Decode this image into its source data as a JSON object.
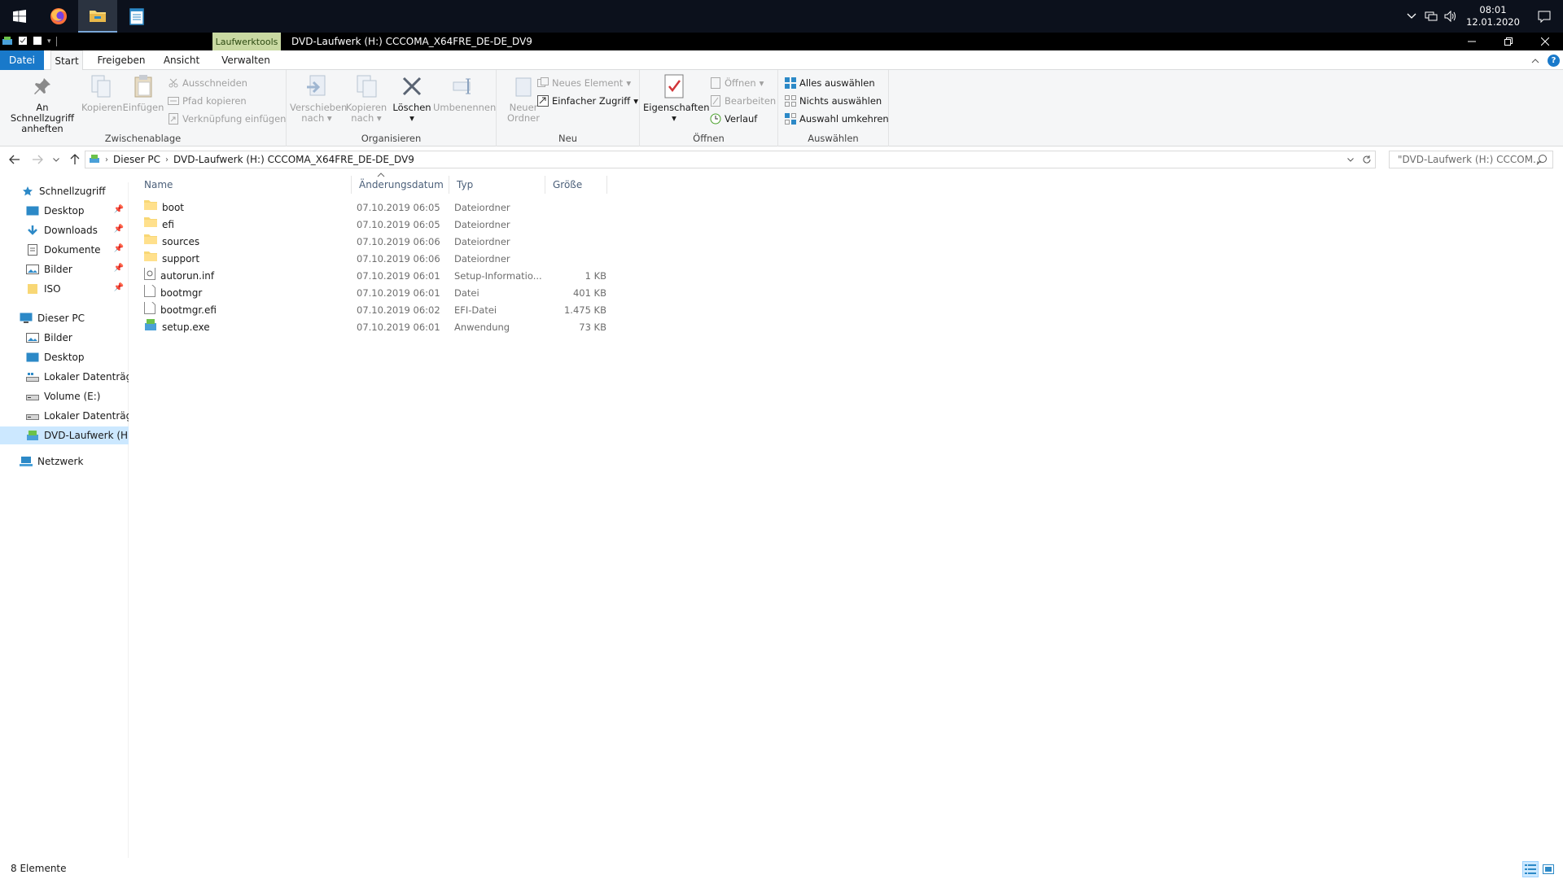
{
  "taskbar": {
    "apps": [
      {
        "name": "firefox-icon"
      },
      {
        "name": "file-explorer-icon"
      },
      {
        "name": "notepad-icon"
      }
    ],
    "clock": {
      "time": "08:01",
      "date": "12.01.2020"
    }
  },
  "titlebar": {
    "context_tab": "Laufwerktools",
    "title": "DVD-Laufwerk (H:) CCCOMA_X64FRE_DE-DE_DV9"
  },
  "ribbon_tabs": [
    "Datei",
    "Start",
    "Freigeben",
    "Ansicht",
    "Verwalten"
  ],
  "ribbon": {
    "zwischenablage": {
      "label": "Zwischenablage",
      "pin": "An Schnellzugriff anheften",
      "copy": "Kopieren",
      "paste": "Einfügen",
      "cut": "Ausschneiden",
      "copy_path": "Pfad kopieren",
      "paste_shortcut": "Verknüpfung einfügen"
    },
    "organisieren": {
      "label": "Organisieren",
      "move_to": "Verschieben nach",
      "copy_to": "Kopieren nach",
      "delete": "Löschen",
      "rename": "Umbenennen"
    },
    "neu": {
      "label": "Neu",
      "new_folder": "Neuer Ordner",
      "new_item": "Neues Element",
      "easy_access": "Einfacher Zugriff"
    },
    "oeffnen": {
      "label": "Öffnen",
      "properties": "Eigenschaften",
      "open": "Öffnen",
      "edit": "Bearbeiten",
      "history": "Verlauf"
    },
    "auswaehlen": {
      "label": "Auswählen",
      "select_all": "Alles auswählen",
      "select_none": "Nichts auswählen",
      "invert": "Auswahl umkehren"
    }
  },
  "address": {
    "crumbs": [
      "Dieser PC",
      "DVD-Laufwerk (H:) CCCOMA_X64FRE_DE-DE_DV9"
    ],
    "search_placeholder": "\"DVD-Laufwerk (H:) CCCOM..."
  },
  "nav": {
    "quick_access": "Schnellzugriff",
    "quick_items": [
      "Desktop",
      "Downloads",
      "Dokumente",
      "Bilder",
      "ISO"
    ],
    "this_pc": "Dieser PC",
    "pc_items": [
      "Bilder",
      "Desktop",
      "Lokaler Datenträger",
      "Volume (E:)",
      "Lokaler Datenträger",
      "DVD-Laufwerk (H:)"
    ],
    "network": "Netzwerk"
  },
  "columns": {
    "name": "Name",
    "date": "Änderungsdatum",
    "type": "Typ",
    "size": "Größe"
  },
  "files": [
    {
      "name": "boot",
      "date": "07.10.2019 06:05",
      "type": "Dateiordner",
      "size": "",
      "icon": "folder-icon"
    },
    {
      "name": "efi",
      "date": "07.10.2019 06:05",
      "type": "Dateiordner",
      "size": "",
      "icon": "folder-icon"
    },
    {
      "name": "sources",
      "date": "07.10.2019 06:06",
      "type": "Dateiordner",
      "size": "",
      "icon": "folder-icon"
    },
    {
      "name": "support",
      "date": "07.10.2019 06:06",
      "type": "Dateiordner",
      "size": "",
      "icon": "folder-icon"
    },
    {
      "name": "autorun.inf",
      "date": "07.10.2019 06:01",
      "type": "Setup-Informatio...",
      "size": "1 KB",
      "icon": "setup-info-icon"
    },
    {
      "name": "bootmgr",
      "date": "07.10.2019 06:01",
      "type": "Datei",
      "size": "401 KB",
      "icon": "file-icon"
    },
    {
      "name": "bootmgr.efi",
      "date": "07.10.2019 06:02",
      "type": "EFI-Datei",
      "size": "1.475 KB",
      "icon": "file-icon"
    },
    {
      "name": "setup.exe",
      "date": "07.10.2019 06:01",
      "type": "Anwendung",
      "size": "73 KB",
      "icon": "setup-exe-icon"
    }
  ],
  "status": {
    "count": "8 Elemente"
  },
  "colors": {
    "accent": "#1979ca",
    "folder": "#f8d775",
    "selected": "#cce8ff",
    "ribbon_bg": "#f5f6f7",
    "context_tab": "#c9d9a2"
  }
}
